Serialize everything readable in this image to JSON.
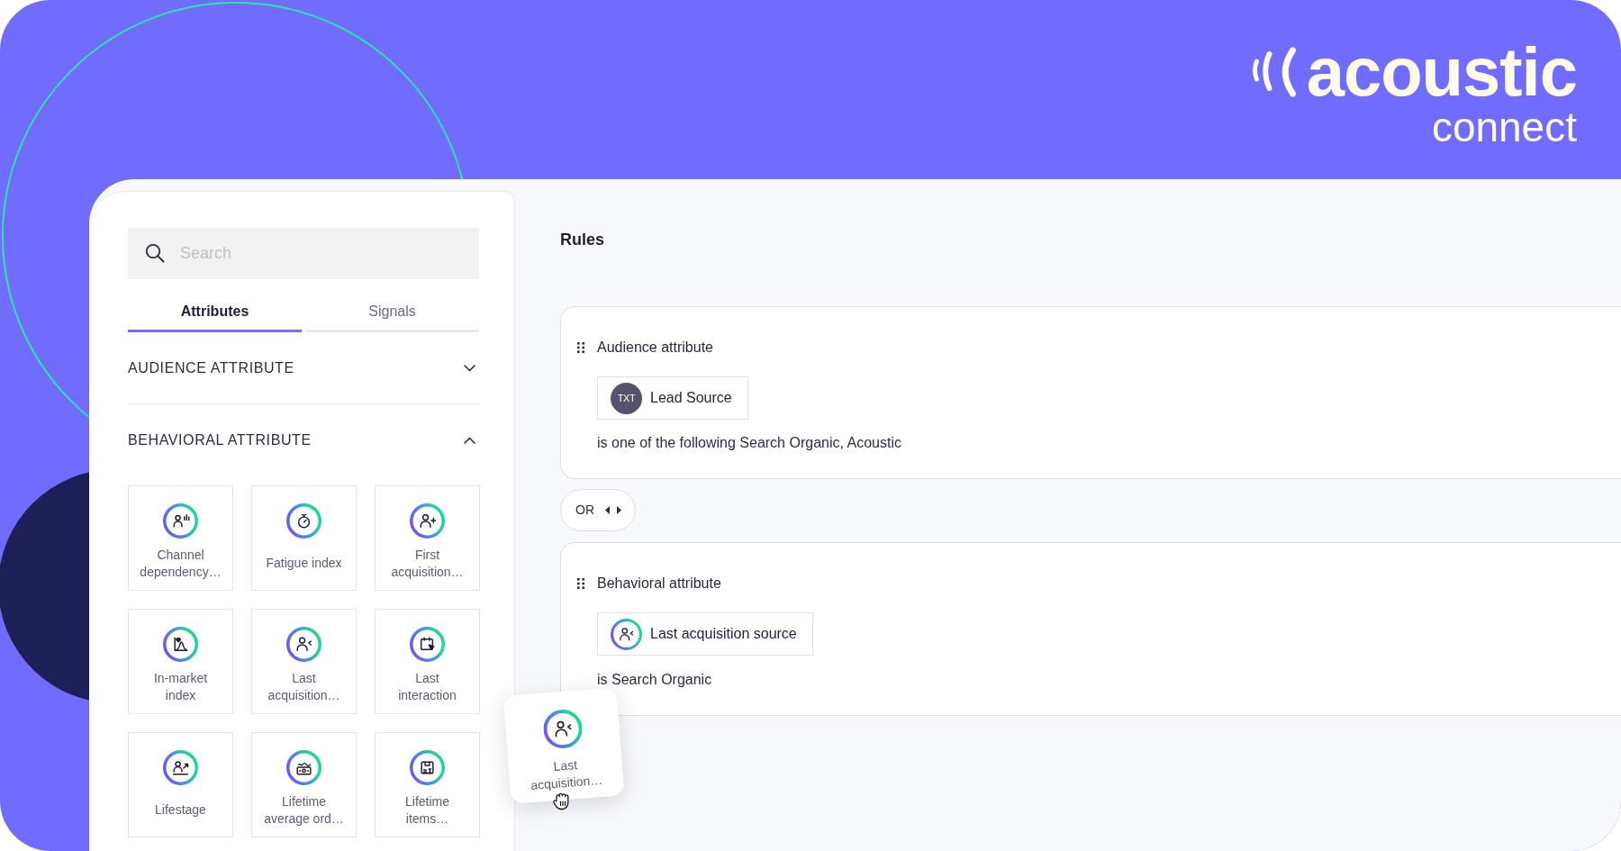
{
  "logo": {
    "wordmark": "acoustic",
    "product": "connect"
  },
  "sidebar": {
    "search": {
      "placeholder": "Search"
    },
    "tabs": [
      {
        "label": "Attributes",
        "selected": true
      },
      {
        "label": "Signals",
        "selected": false
      }
    ],
    "sections": [
      {
        "title": "AUDIENCE ATTRIBUTE",
        "expanded": false
      },
      {
        "title": "BEHAVIORAL ATTRIBUTE",
        "expanded": true,
        "items": [
          {
            "label": "Channel dependency…"
          },
          {
            "label": "Fatigue index"
          },
          {
            "label": "First acquisition…"
          },
          {
            "label": "In-market index"
          },
          {
            "label": "Last acquisition…"
          },
          {
            "label": "Last interaction"
          },
          {
            "label": "Lifestage"
          },
          {
            "label": "Lifetime average ord…"
          },
          {
            "label": "Lifetime items…"
          }
        ]
      }
    ]
  },
  "rules": {
    "title": "Rules",
    "items": [
      {
        "kind": "rule",
        "heading": "Audience attribute",
        "chip": {
          "kind": "text",
          "badge": "TXT",
          "label": "Lead Source"
        },
        "condition": "is one of the following Search Organic, Acoustic"
      },
      {
        "kind": "operator",
        "label": "OR"
      },
      {
        "kind": "rule",
        "heading": "Behavioral attribute",
        "chip": {
          "kind": "icon",
          "label": "Last acquisition source"
        },
        "condition": "is Search Organic"
      }
    ]
  },
  "drag_preview": {
    "label": "Last acquisition…"
  }
}
